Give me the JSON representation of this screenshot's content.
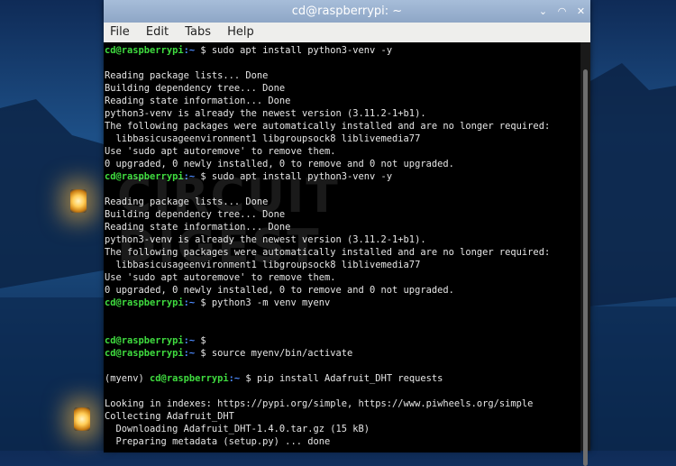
{
  "window": {
    "title": "cd@raspberrypi: ~",
    "controls": {
      "minimize": "⌄",
      "maximize": "◠",
      "close": "✕"
    }
  },
  "menu": [
    "File",
    "Edit",
    "Tabs",
    "Help"
  ],
  "prompt": {
    "user": "cd@raspberrypi",
    "path": ":~",
    "symbol": " $ "
  },
  "terminal_lines": [
    {
      "kind": "prompt",
      "cmd": "sudo apt install python3-venv -y"
    },
    {
      "kind": "blank"
    },
    {
      "kind": "out",
      "text": "Reading package lists... Done"
    },
    {
      "kind": "out",
      "text": "Building dependency tree... Done"
    },
    {
      "kind": "out",
      "text": "Reading state information... Done"
    },
    {
      "kind": "out",
      "text": "python3-venv is already the newest version (3.11.2-1+b1)."
    },
    {
      "kind": "out",
      "text": "The following packages were automatically installed and are no longer required:"
    },
    {
      "kind": "out",
      "text": "  libbasicusageenvironment1 libgroupsock8 liblivemedia77"
    },
    {
      "kind": "out",
      "text": "Use 'sudo apt autoremove' to remove them."
    },
    {
      "kind": "out",
      "text": "0 upgraded, 0 newly installed, 0 to remove and 0 not upgraded."
    },
    {
      "kind": "prompt",
      "cmd": "sudo apt install python3-venv -y"
    },
    {
      "kind": "blank"
    },
    {
      "kind": "out",
      "text": "Reading package lists... Done"
    },
    {
      "kind": "out",
      "text": "Building dependency tree... Done"
    },
    {
      "kind": "out",
      "text": "Reading state information... Done"
    },
    {
      "kind": "out",
      "text": "python3-venv is already the newest version (3.11.2-1+b1)."
    },
    {
      "kind": "out",
      "text": "The following packages were automatically installed and are no longer required:"
    },
    {
      "kind": "out",
      "text": "  libbasicusageenvironment1 libgroupsock8 liblivemedia77"
    },
    {
      "kind": "out",
      "text": "Use 'sudo apt autoremove' to remove them."
    },
    {
      "kind": "out",
      "text": "0 upgraded, 0 newly installed, 0 to remove and 0 not upgraded."
    },
    {
      "kind": "prompt",
      "cmd": "python3 -m venv myenv"
    },
    {
      "kind": "blank"
    },
    {
      "kind": "blank"
    },
    {
      "kind": "prompt",
      "cmd": ""
    },
    {
      "kind": "prompt",
      "cmd": "source myenv/bin/activate"
    },
    {
      "kind": "blank"
    },
    {
      "kind": "venv-prompt",
      "venv": "(myenv) ",
      "cmd": "pip install Adafruit_DHT requests"
    },
    {
      "kind": "blank"
    },
    {
      "kind": "out",
      "text": "Looking in indexes: https://pypi.org/simple, https://www.piwheels.org/simple"
    },
    {
      "kind": "out",
      "text": "Collecting Adafruit_DHT"
    },
    {
      "kind": "out",
      "text": "  Downloading Adafruit_DHT-1.4.0.tar.gz (15 kB)"
    },
    {
      "kind": "out",
      "text": "  Preparing metadata (setup.py) ... done"
    }
  ],
  "watermark": [
    "CIRCUIT",
    "DIGEST"
  ]
}
